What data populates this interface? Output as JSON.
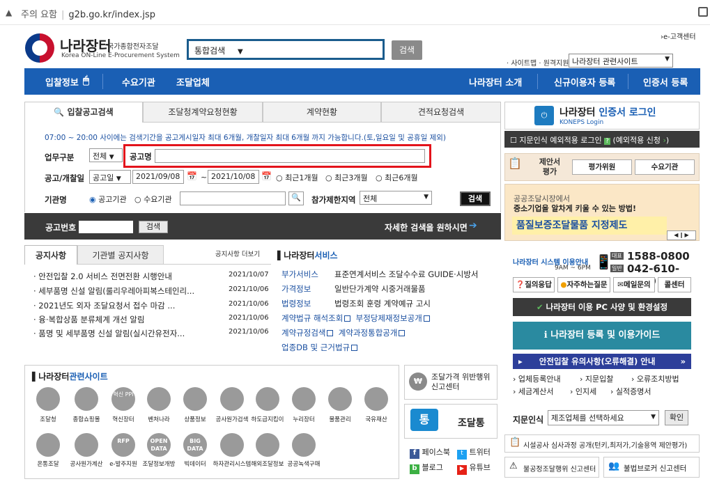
{
  "browser": {
    "security_warning": "주의 요함",
    "url": "g2b.go.kr/index.jsp"
  },
  "header": {
    "logo_name": "나라장터",
    "logo_sub1": "국가종합전자조달",
    "logo_sub2": "Korea ON-Line E-Procurement System",
    "search_select": "통합검색",
    "search_button": "검색",
    "customer_center": "›e-고객센터",
    "site_label": "· 사이트맵 · 원격지원",
    "site_select": "나라장터 관련사이트"
  },
  "nav": {
    "items": [
      "입찰정보",
      "수요기관",
      "조달업체"
    ],
    "right_items": [
      "나라장터 소개",
      "신규이용자 등록",
      "인증서 등록"
    ]
  },
  "search": {
    "tabs": [
      "입찰공고검색",
      "조달청계약요청현황",
      "계약현황",
      "견적요청검색"
    ],
    "notice": "07:00 ~ 20:00 사이에는 검색기간을 공고게시일자 최대 6개월, 개찰일자 최대 6개월 까지 가능합니다.(토,일요일 및 공휴일 제외)",
    "biz_type_label": "업무구분",
    "biz_type_value": "전체",
    "notice_name_label": "공고명",
    "notice_name_value": "",
    "date_label": "공고/개찰일",
    "date_type": "공고일",
    "date_from": "2021/09/08",
    "date_to": "2021/10/08",
    "tilde": "~",
    "date_options": [
      "최근1개월",
      "최근3개월",
      "최근6개월"
    ],
    "agency_label": "기관명",
    "agency_options": [
      "공고기관",
      "수요기관"
    ],
    "region_label": "참가제한지역",
    "region_value": "전체",
    "search_button": "검색",
    "bid_number_label": "공고번호",
    "bid_search_button": "검색",
    "detailed_search": "자세한 검색을 원하시면"
  },
  "notices": {
    "tabs": [
      "공지사항",
      "기관별 공지사항"
    ],
    "more": "공지사항 더보기",
    "items": [
      {
        "title": "· 안전입찰 2.0 서비스 전면전환 시행안내",
        "date": "2021/10/07"
      },
      {
        "title": "· 세부품명 신설 알림(룰리우레아피복스테인리...",
        "date": "2021/10/06"
      },
      {
        "title": "· 2021년도 외자 조달요청서 접수 마감 ...",
        "date": "2021/10/06"
      },
      {
        "title": "· 융·복합상품 분류체계 개선 알림",
        "date": "2021/10/06"
      },
      {
        "title": "· 품명 및 세부품명 신설 알림(실시간유전자...",
        "date": "2021/10/06"
      }
    ]
  },
  "services": {
    "title_prefix": "나라장터",
    "title_suffix": "서비스",
    "rows": [
      {
        "key": "부가서비스",
        "value": "표준연계서비스 조달수수료 GUIDE·시방서"
      },
      {
        "key": "가격정보",
        "value": "일반단가계약 시중거래물품"
      },
      {
        "key": "법령정보",
        "value": "법령조회  훈령  계약예규  고시"
      }
    ],
    "links": [
      "계약법규 해석조회",
      "부정당제재정보공개",
      "계약규정검색",
      "계약과정통합공개",
      "업종DB 및 근거법규"
    ]
  },
  "related": {
    "title_prefix": "나라장터",
    "title_suffix": "관련사이트",
    "row1": [
      "조달청",
      "종합쇼핑몰",
      "혁신장터",
      "벤처나라",
      "상품정보",
      "공사원가검색",
      "하도급지킴이",
      "누리장터",
      "물품관리",
      "국유재산"
    ],
    "row2": [
      "온통조달",
      "공사원가계산",
      "e-발주지원",
      "조달정보개방",
      "빅데이터",
      "하자관리시스템",
      "해외조달정보",
      "공공녹색구매"
    ],
    "icon_text": [
      "혁신 PPI",
      "RFP",
      "OPEN DATA",
      "BIG DATA"
    ]
  },
  "mid": {
    "report_center": "조달가격 위반행위 신고센터",
    "tong_badge": "통",
    "tong_text": "조달통",
    "sns": [
      "페이스북",
      "트위터",
      "블로그",
      "유튜브"
    ]
  },
  "right": {
    "cert_login": "나라장터",
    "cert_login2": "인증서 로그인",
    "koneps": "KONEPS Login",
    "finger": "지문인식 예외적용 로그인",
    "finger_apply": "(예외적용 신청",
    "eval_title": "제안서 평가",
    "eval_btns": [
      "평가위원",
      "수요기관"
    ],
    "banner1": "공공조달시장에서",
    "banner2": "중소기업을 알차게 키울 수 있는 방법!",
    "banner3": "품질보증조달물품 지정제도",
    "helpdesk": "나라장터 시스템 이용안내",
    "hours": "9AM ~ 6PM",
    "tel_label": "대표",
    "tel": "1588-0800",
    "tel2_label": "일반",
    "tel2": "042-610-1200",
    "help_btns": [
      "질의응답",
      "자주하는질문",
      "메일문의",
      "콜센터"
    ],
    "pc_spec": "나라장터 이용 PC 사양 및 환경설정",
    "guide": "나라장터 등록 및 이용가이드",
    "safe_bid": "안전입찰 유의사항(오류해결) 안내",
    "links": [
      "› 업체등록안내",
      "› 지문입찰",
      "› 오류조치방법",
      "› 세금계산서",
      "› 인지세",
      "› 실적증명서"
    ],
    "finger_label": "지문인식",
    "finger_select": "제조업체를 선택하세요",
    "confirm": "확인",
    "audit": "시설공사 심사과정 공개(턴키,최저가,기술용역 제안평가)",
    "unfair": "불공정조달행위 신고센터",
    "broker": "불법브로커 신고센터"
  }
}
